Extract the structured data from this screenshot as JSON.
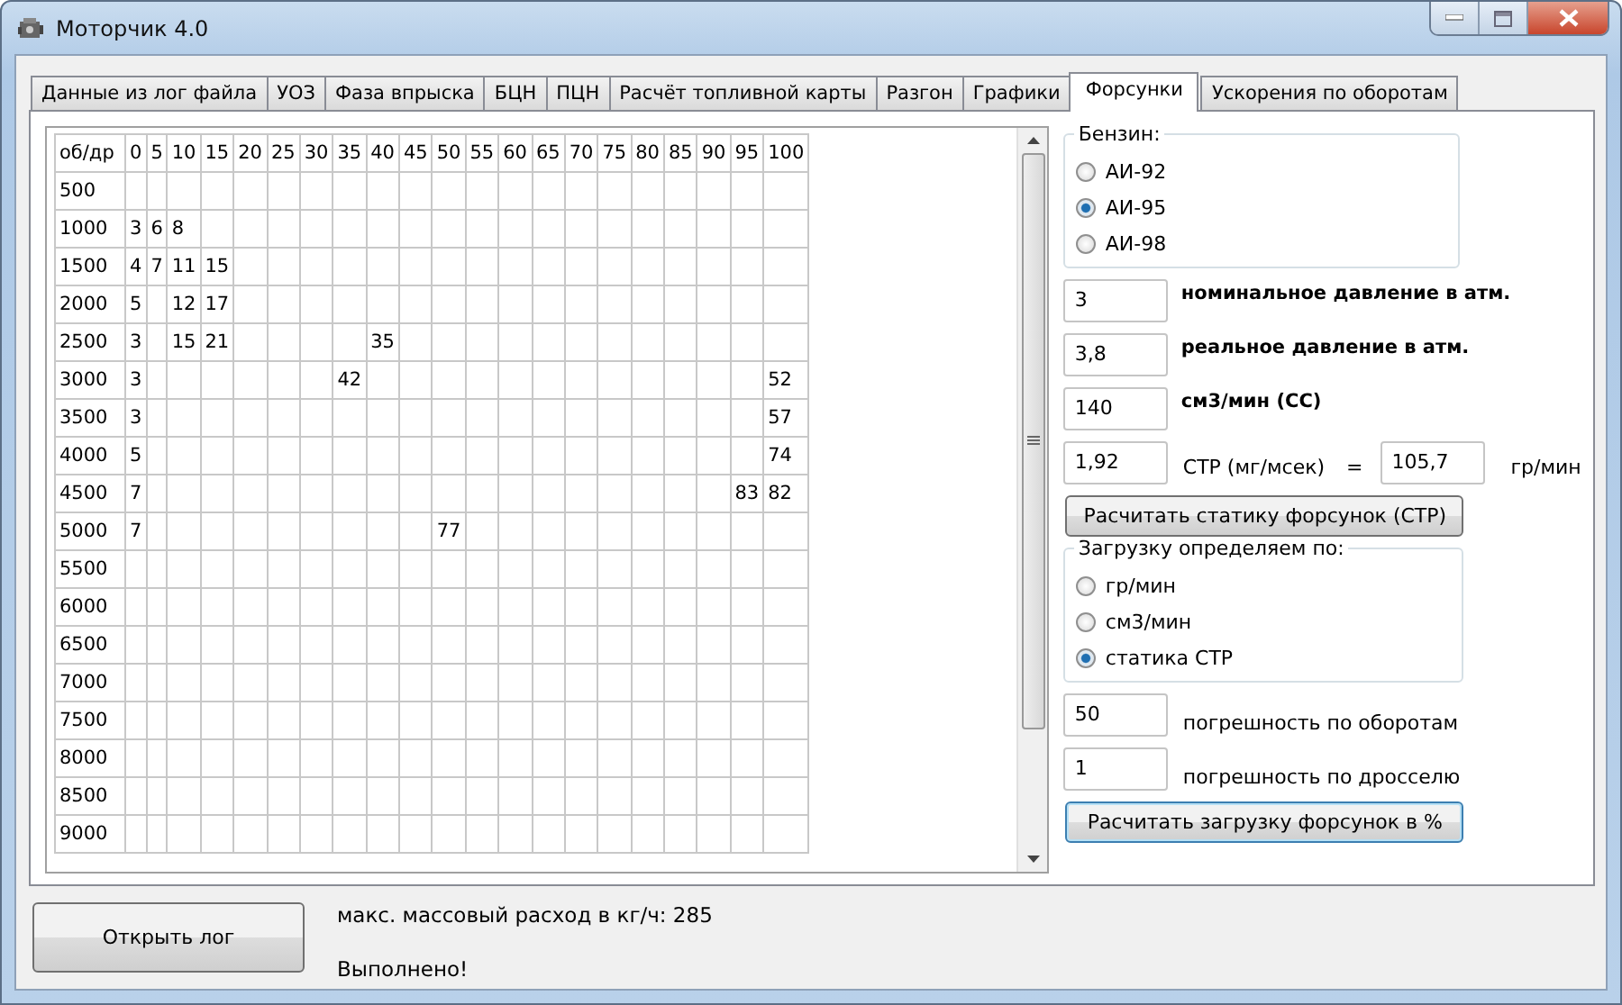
{
  "window": {
    "title": "Моторчик 4.0"
  },
  "tabs": [
    {
      "label": "Данные из лог файла",
      "selected": false
    },
    {
      "label": "УОЗ",
      "selected": false
    },
    {
      "label": "Фаза впрыска",
      "selected": false
    },
    {
      "label": "БЦН",
      "selected": false
    },
    {
      "label": "ПЦН",
      "selected": false
    },
    {
      "label": "Расчёт топливной карты",
      "selected": false
    },
    {
      "label": "Разгон",
      "selected": false
    },
    {
      "label": "Графики",
      "selected": false
    },
    {
      "label": "Форсунки",
      "selected": true
    },
    {
      "label": "Ускорения по оборотам",
      "selected": false
    }
  ],
  "table": {
    "corner": "об/др",
    "columns": [
      "0",
      "5",
      "10",
      "15",
      "20",
      "25",
      "30",
      "35",
      "40",
      "45",
      "50",
      "55",
      "60",
      "65",
      "70",
      "75",
      "80",
      "85",
      "90",
      "95",
      "100"
    ],
    "rows": [
      {
        "rpm": "500",
        "cells": [
          null,
          null,
          null,
          null,
          null,
          null,
          null,
          null,
          null,
          null,
          null,
          null,
          null,
          null,
          null,
          null,
          null,
          null,
          null,
          null,
          null
        ]
      },
      {
        "rpm": "1000",
        "cells": [
          "3",
          "6",
          "8",
          null,
          null,
          null,
          null,
          null,
          null,
          null,
          null,
          null,
          null,
          null,
          null,
          null,
          null,
          null,
          null,
          null,
          null
        ]
      },
      {
        "rpm": "1500",
        "cells": [
          "4",
          "7",
          "11",
          "15",
          null,
          null,
          null,
          null,
          null,
          null,
          null,
          null,
          null,
          null,
          null,
          null,
          null,
          null,
          null,
          null,
          null
        ]
      },
      {
        "rpm": "2000",
        "cells": [
          "5",
          null,
          "12",
          "17",
          null,
          null,
          null,
          null,
          null,
          null,
          null,
          null,
          null,
          null,
          null,
          null,
          null,
          null,
          null,
          null,
          null
        ]
      },
      {
        "rpm": "2500",
        "cells": [
          "3",
          null,
          "15",
          "21",
          null,
          null,
          null,
          null,
          "35",
          null,
          null,
          null,
          null,
          null,
          null,
          null,
          null,
          null,
          null,
          null,
          null
        ]
      },
      {
        "rpm": "3000",
        "cells": [
          "3",
          null,
          null,
          null,
          null,
          null,
          null,
          "42",
          null,
          null,
          null,
          null,
          null,
          null,
          null,
          null,
          null,
          null,
          null,
          null,
          "52"
        ]
      },
      {
        "rpm": "3500",
        "cells": [
          "3",
          null,
          null,
          null,
          null,
          null,
          null,
          null,
          null,
          null,
          null,
          null,
          null,
          null,
          null,
          null,
          null,
          null,
          null,
          null,
          "57"
        ]
      },
      {
        "rpm": "4000",
        "cells": [
          "5",
          null,
          null,
          null,
          null,
          null,
          null,
          null,
          null,
          null,
          null,
          null,
          null,
          null,
          null,
          null,
          null,
          null,
          null,
          null,
          "74"
        ]
      },
      {
        "rpm": "4500",
        "cells": [
          "7",
          null,
          null,
          null,
          null,
          null,
          null,
          null,
          null,
          null,
          null,
          null,
          null,
          null,
          null,
          null,
          null,
          null,
          null,
          "83",
          "82"
        ]
      },
      {
        "rpm": "5000",
        "cells": [
          "7",
          null,
          null,
          null,
          null,
          null,
          null,
          null,
          null,
          null,
          "77",
          null,
          null,
          null,
          null,
          null,
          null,
          null,
          null,
          null,
          null
        ]
      },
      {
        "rpm": "5500",
        "cells": [
          null,
          null,
          null,
          null,
          null,
          null,
          null,
          null,
          null,
          null,
          null,
          null,
          null,
          null,
          null,
          null,
          null,
          null,
          null,
          null,
          null
        ]
      },
      {
        "rpm": "6000",
        "cells": [
          null,
          null,
          null,
          null,
          null,
          null,
          null,
          null,
          null,
          null,
          null,
          null,
          null,
          null,
          null,
          null,
          null,
          null,
          null,
          null,
          null
        ]
      },
      {
        "rpm": "6500",
        "cells": [
          null,
          null,
          null,
          null,
          null,
          null,
          null,
          null,
          null,
          null,
          null,
          null,
          null,
          null,
          null,
          null,
          null,
          null,
          null,
          null,
          null
        ]
      },
      {
        "rpm": "7000",
        "cells": [
          null,
          null,
          null,
          null,
          null,
          null,
          null,
          null,
          null,
          null,
          null,
          null,
          null,
          null,
          null,
          null,
          null,
          null,
          null,
          null,
          null
        ]
      },
      {
        "rpm": "7500",
        "cells": [
          null,
          null,
          null,
          null,
          null,
          null,
          null,
          null,
          null,
          null,
          null,
          null,
          null,
          null,
          null,
          null,
          null,
          null,
          null,
          null,
          null
        ]
      },
      {
        "rpm": "8000",
        "cells": [
          null,
          null,
          null,
          null,
          null,
          null,
          null,
          null,
          null,
          null,
          null,
          null,
          null,
          null,
          null,
          null,
          null,
          null,
          null,
          null,
          null
        ]
      },
      {
        "rpm": "8500",
        "cells": [
          null,
          null,
          null,
          null,
          null,
          null,
          null,
          null,
          null,
          null,
          null,
          null,
          null,
          null,
          null,
          null,
          null,
          null,
          null,
          null,
          null
        ]
      },
      {
        "rpm": "9000",
        "cells": [
          null,
          null,
          null,
          null,
          null,
          null,
          null,
          null,
          null,
          null,
          null,
          null,
          null,
          null,
          null,
          null,
          null,
          null,
          null,
          null,
          null
        ]
      }
    ]
  },
  "fuel_group": {
    "title": "Бензин:",
    "options": [
      {
        "label": "АИ-92",
        "selected": false
      },
      {
        "label": "АИ-95",
        "selected": true
      },
      {
        "label": "АИ-98",
        "selected": false
      }
    ]
  },
  "pressure_fields": [
    {
      "value": "3",
      "label": "номинальное давление в атм.",
      "bold": true
    },
    {
      "value": "3,8",
      "label": "реальное давление в атм.",
      "bold": true
    },
    {
      "value": "140",
      "label": "см3/мин (СС)",
      "bold": true
    }
  ],
  "str_row": {
    "value": "1,92",
    "label": "СТР (мг/мсек)",
    "equals": "=",
    "result": "105,7",
    "unit": "гр/мин"
  },
  "static_button": {
    "label": "Расчитать статику форсунок (СТР)",
    "focused": false
  },
  "load_group": {
    "title": "Загрузку определяем по:",
    "options": [
      {
        "label": "гр/мин",
        "selected": false
      },
      {
        "label": "см3/мин",
        "selected": false
      },
      {
        "label": "статика СТР",
        "selected": true
      }
    ]
  },
  "tolerance_fields": [
    {
      "value": "50",
      "label": "погрешность по оборотам"
    },
    {
      "value": "1",
      "label": "погрешность по дросселю"
    }
  ],
  "load_button": {
    "label": "Расчитать загрузку форсунок в %",
    "focused": true
  },
  "open_button": {
    "label": "Открыть лог"
  },
  "max_flow_text": "макс. массовый расход в кг/ч: 285",
  "status_text": "Выполнено!"
}
